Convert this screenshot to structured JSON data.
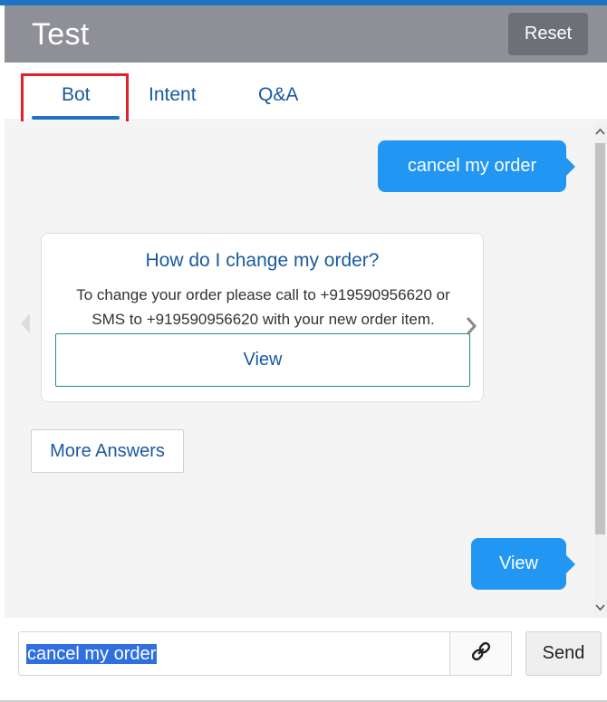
{
  "header": {
    "title": "Test",
    "reset_label": "Reset",
    "accent_color": "#1f73c2",
    "background_color": "#8f9097"
  },
  "tabs": [
    {
      "label": "Bot",
      "active": true
    },
    {
      "label": "Intent",
      "active": false
    },
    {
      "label": "Q&A",
      "active": false
    }
  ],
  "chat": {
    "messages": [
      {
        "from": "user",
        "text": "cancel my order"
      },
      {
        "from": "bot",
        "card": {
          "title": "How do I change my order?",
          "body": "To change your order please call to +919590956620 or SMS to +919590956620 with your new order item.",
          "button_label": "View"
        },
        "icons": {
          "prev": "chevron-left-icon",
          "next": "chevron-right-icon"
        }
      },
      {
        "from": "bot",
        "button_label": "More Answers"
      },
      {
        "from": "user",
        "text": "View"
      }
    ],
    "bubble_color": "#2196f3"
  },
  "composer": {
    "input_value": "cancel my order",
    "attach_icon": "link-icon",
    "send_label": "Send"
  },
  "scrollbar": {
    "up_icon": "chevron-up-icon",
    "down_icon": "chevron-down-icon"
  }
}
